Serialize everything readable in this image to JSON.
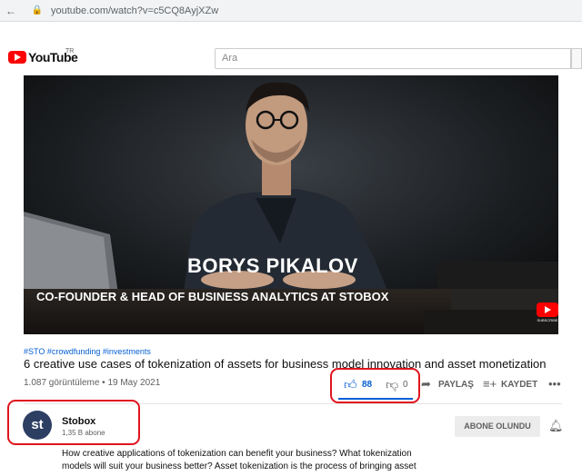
{
  "browser": {
    "url": "youtube.com/watch?v=c5CQ8AyjXZw"
  },
  "header": {
    "logo_text": "YouTube",
    "region": "TR",
    "search_placeholder": "Ara"
  },
  "video": {
    "overlay_name": "BORYS PIKALOV",
    "overlay_role": "CO-FOUNDER & HEAD OF BUSINESS ANALYTICS AT STOBOX",
    "corner_logo_text": "SUBSCRIBE"
  },
  "meta": {
    "hashtags": "#STO #crowdfunding #investments",
    "title": "6 creative use cases of tokenization of assets for business model innovation and asset monetization",
    "views_date": "1.087 görüntüleme • 19 May 2021"
  },
  "actions": {
    "like_count": "88",
    "dislike_count": "0",
    "share_label": "PAYLAŞ",
    "save_label": "KAYDET",
    "like_ratio": 1.0
  },
  "channel": {
    "avatar_text": "st",
    "name": "Stobox",
    "subscribers": "1,35 B abone",
    "subscribe_label": "ABONE OLUNDU"
  },
  "description": {
    "line1": "How creative applications of tokenization can benefit your business? What tokenization",
    "line2": "models will suit your business better? Asset tokenization is the process of bringing asset"
  },
  "colors": {
    "brand_red": "#ff0000",
    "link_blue": "#065fd4",
    "annotation_red": "#e0141e"
  }
}
